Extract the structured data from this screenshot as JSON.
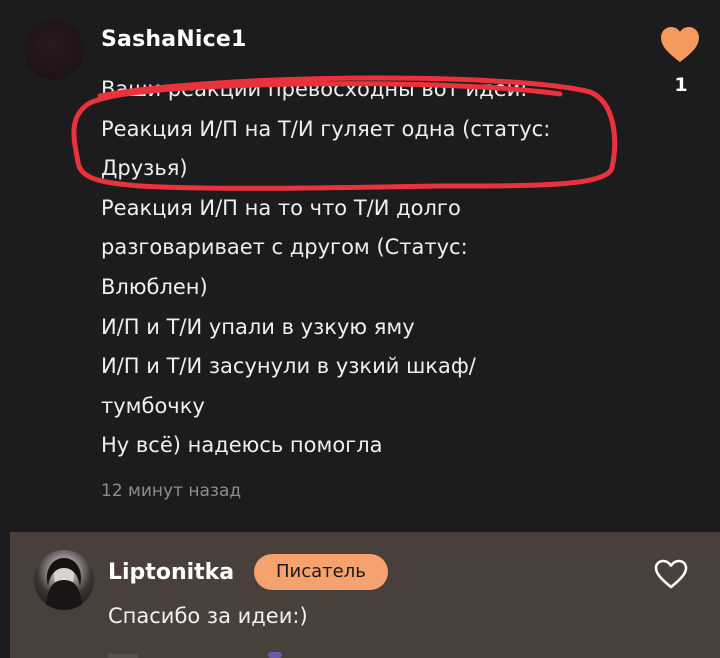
{
  "comment": {
    "username": "SashaNice1",
    "likes": "1",
    "lines": [
      "Ваши реакции превосходны вот идеи:",
      "Реакция И/П на Т/И гуляет одна (статус:",
      "Друзья)",
      "Реакция И/П на то что Т/И долго",
      "разговаривает с другом (Статус:",
      "Влюблен)",
      "И/П и Т/И упали в узкую яму",
      "И/П и Т/И засунули в узкий шкаф/",
      "тумбочку",
      "Ну всё) надеюсь помогла"
    ],
    "timestamp": "12 минут назад"
  },
  "reply": {
    "username": "Liptonitka",
    "badge": "Писатель",
    "text": "Спасибо за идеи:)"
  },
  "icons": {
    "like_filled": "heart-filled-icon",
    "like_outline": "heart-outline-icon"
  },
  "colors": {
    "background": "#1c1b1d",
    "reply_background": "#4a403b",
    "heart": "#f59a5e",
    "badge": "#f6a26e",
    "annotation": "#e8333d"
  }
}
